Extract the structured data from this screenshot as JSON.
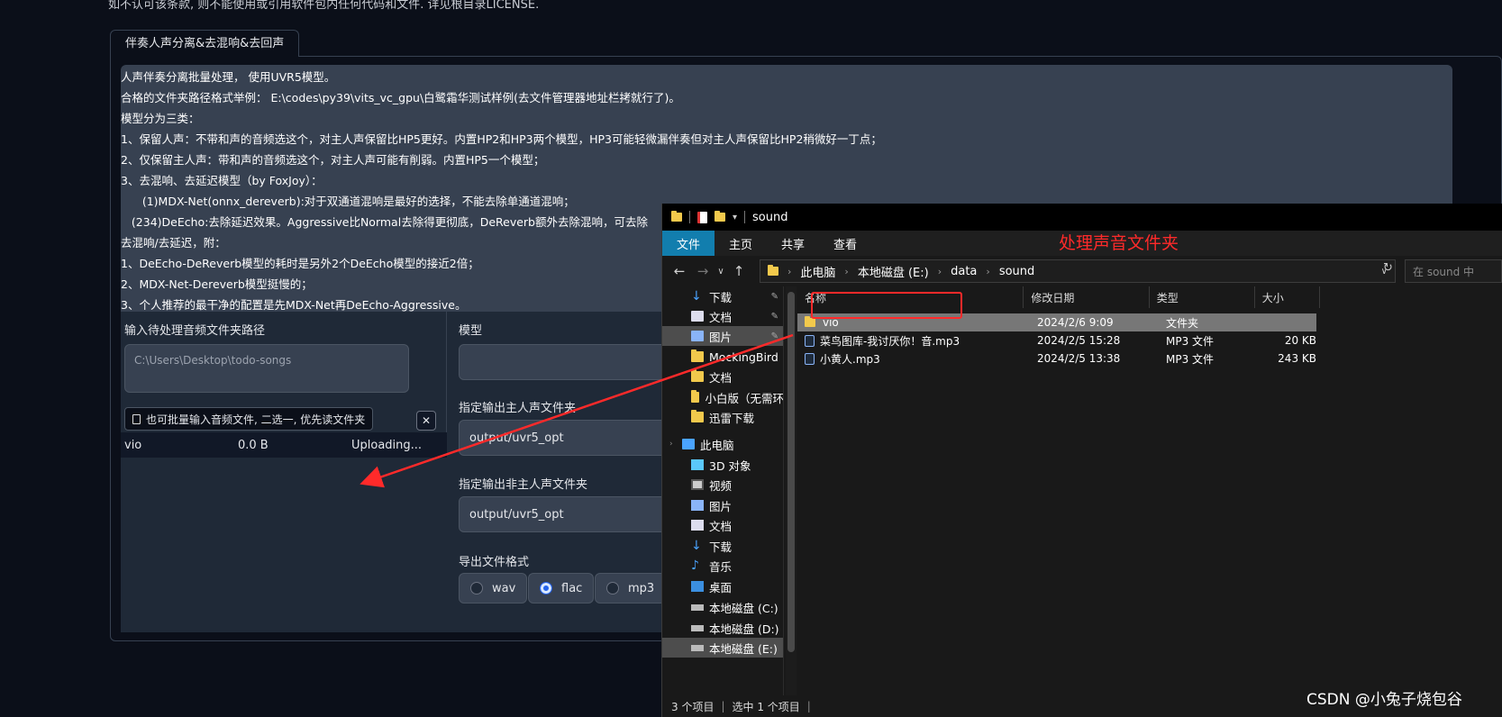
{
  "top_notice": "如不认可该条款, 则不能使用或引用软件包内任何代码和文件. 详见根目录LICENSE.",
  "tab_label": "伴奏人声分离&去混响&去回声",
  "description_lines": [
    "人声伴奏分离批量处理， 使用UVR5模型。",
    "合格的文件夹路径格式举例： E:\\codes\\py39\\vits_vc_gpu\\白鹭霜华测试样例(去文件管理器地址栏拷就行了)。",
    "模型分为三类：",
    "1、保留人声：不带和声的音频选这个，对主人声保留比HP5更好。内置HP2和HP3两个模型，HP3可能轻微漏伴奏但对主人声保留比HP2稍微好一丁点；",
    "2、仅保留主人声：带和声的音频选这个，对主人声可能有削弱。内置HP5一个模型；",
    "3、去混响、去延迟模型（by FoxJoy）：",
    "      (1)MDX-Net(onnx_dereverb):对于双通道混响是最好的选择，不能去除单通道混响；",
    "   (234)DeEcho:去除延迟效果。Aggressive比Normal去除得更彻底，DeReverb额外去除混响，可去除",
    "去混响/去延迟，附：",
    "1、DeEcho-DeReverb模型的耗时是另外2个DeEcho模型的接近2倍；",
    "2、MDX-Net-Dereverb模型挺慢的；",
    "3、个人推荐的最干净的配置是先MDX-Net再DeEcho-Aggressive。"
  ],
  "input_folder": {
    "label": "输入待处理音频文件夹路径",
    "placeholder": "C:\\Users\\Desktop\\todo-songs"
  },
  "file_upload": {
    "label": "也可批量输入音频文件, 二选一, 优先读文件夹",
    "file_name": "vio",
    "file_size": "0.0 B",
    "status": "Uploading..."
  },
  "model": {
    "label": "模型"
  },
  "output_main": {
    "label": "指定输出主人声文件夹",
    "value": "output/uvr5_opt"
  },
  "output_other": {
    "label": "指定输出非主人声文件夹",
    "value": "output/uvr5_opt"
  },
  "export_format": {
    "label": "导出文件格式",
    "options": [
      "wav",
      "flac",
      "mp3"
    ],
    "selected": "flac"
  },
  "explorer": {
    "title": "sound",
    "ribbon_tabs": [
      "文件",
      "主页",
      "共享",
      "查看"
    ],
    "annotation": "处理声音文件夹",
    "breadcrumb": [
      "此电脑",
      "本地磁盘 (E:)",
      "data",
      "sound"
    ],
    "search_placeholder": "在 sound 中",
    "nav_items": [
      {
        "label": "下载",
        "icon": "download-icon",
        "pinned": true
      },
      {
        "label": "文档",
        "icon": "document-icon",
        "pinned": true
      },
      {
        "label": "图片",
        "icon": "picture-icon",
        "pinned": true,
        "selected": true
      },
      {
        "label": "MockingBird",
        "icon": "folder-icon"
      },
      {
        "label": "文档",
        "icon": "folder-icon"
      },
      {
        "label": "小白版（无需环",
        "icon": "folder-icon"
      },
      {
        "label": "迅雷下载",
        "icon": "folder-icon"
      },
      {
        "label": "此电脑",
        "icon": "computer-icon"
      },
      {
        "label": "3D 对象",
        "icon": "cube-icon"
      },
      {
        "label": "视频",
        "icon": "video-icon"
      },
      {
        "label": "图片",
        "icon": "picture-icon"
      },
      {
        "label": "文档",
        "icon": "document-icon"
      },
      {
        "label": "下载",
        "icon": "download-icon"
      },
      {
        "label": "音乐",
        "icon": "music-icon"
      },
      {
        "label": "桌面",
        "icon": "desktop-icon"
      },
      {
        "label": "本地磁盘 (C:)",
        "icon": "drive-icon"
      },
      {
        "label": "本地磁盘 (D:)",
        "icon": "drive-icon"
      },
      {
        "label": "本地磁盘 (E:)",
        "icon": "drive-icon",
        "selected": true
      }
    ],
    "columns": [
      "名称",
      "修改日期",
      "类型",
      "大小"
    ],
    "files": [
      {
        "name": "vio",
        "date": "2024/2/6 9:09",
        "type": "文件夹",
        "size": "",
        "icon": "folder-icon",
        "selected": true
      },
      {
        "name": "菜鸟图库-我讨厌你！音.mp3",
        "date": "2024/2/5 15:28",
        "type": "MP3 文件",
        "size": "20 KB",
        "icon": "audio-file-icon"
      },
      {
        "name": "小黄人.mp3",
        "date": "2024/2/5 13:38",
        "type": "MP3 文件",
        "size": "243 KB",
        "icon": "audio-file-icon"
      }
    ],
    "status_count": "3 个项目",
    "status_selected": "选中 1 个项目"
  },
  "watermark": "CSDN @小兔子烧包谷",
  "colors": {
    "page_bg": "#0b0f19",
    "panel_bg": "#374151",
    "accent_blue": "#2563eb",
    "ribbon_active": "#127eae",
    "annotation_red": "#ff2a2a"
  }
}
